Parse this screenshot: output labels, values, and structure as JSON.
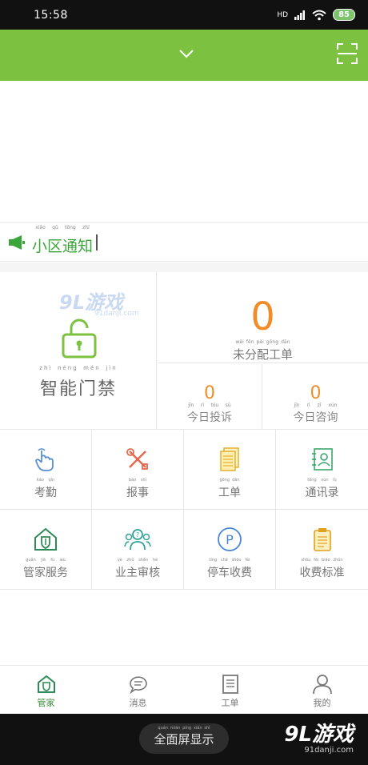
{
  "status_bar": {
    "time": "15:58",
    "network": "HD",
    "battery": "85"
  },
  "notice": {
    "title": "小区通知",
    "title_pinyin": [
      "xiǎo",
      "qū",
      "tōng",
      "zhī"
    ]
  },
  "watermark": {
    "logo": "9L游戏",
    "url": "91danji.com"
  },
  "stats": {
    "gate_label": "智能门禁",
    "gate_pinyin": [
      "zhì",
      "néng",
      "mén",
      "jìn"
    ],
    "unassigned_count": "0",
    "unassigned_label": "未分配工单",
    "unassigned_pinyin": [
      "wèi",
      "fēn",
      "pèi",
      "gōng",
      "dān"
    ],
    "complaints_count": "0",
    "complaints_label": "今日投诉",
    "complaints_pinyin": [
      "jīn",
      "rì",
      "tóu",
      "sù"
    ],
    "consult_count": "0",
    "consult_label": "今日咨询",
    "consult_pinyin": [
      "jīn",
      "rì",
      "zī",
      "xún"
    ]
  },
  "grid": [
    {
      "label": "考勤",
      "pinyin": [
        "kǎo",
        "qín"
      ]
    },
    {
      "label": "报事",
      "pinyin": [
        "bào",
        "shì"
      ]
    },
    {
      "label": "工单",
      "pinyin": [
        "gōng",
        "dān"
      ]
    },
    {
      "label": "通讯录",
      "pinyin": [
        "tōng",
        "xùn",
        "lù"
      ]
    },
    {
      "label": "管家服务",
      "pinyin": [
        "guǎn",
        "jiā",
        "fú",
        "wù"
      ]
    },
    {
      "label": "业主审核",
      "pinyin": [
        "yè",
        "zhǔ",
        "shěn",
        "hé"
      ]
    },
    {
      "label": "停车收费",
      "pinyin": [
        "tíng",
        "chē",
        "shōu",
        "fèi"
      ]
    },
    {
      "label": "收费标准",
      "pinyin": [
        "shōu",
        "fèi",
        "biāo",
        "zhǔn"
      ]
    }
  ],
  "tabs": [
    {
      "label": "管家"
    },
    {
      "label": "消息"
    },
    {
      "label": "工单"
    },
    {
      "label": "我的"
    }
  ],
  "parking_icon_letter": "P",
  "navbar": {
    "fullscreen_label": "全面屏显示",
    "fullscreen_pinyin": [
      "quán",
      "miàn",
      "píng",
      "xiǎn",
      "shì"
    ],
    "brand_logo": "9L游戏",
    "brand_url": "91danji.com"
  },
  "colors": {
    "accent": "#7cc140",
    "number": "#f28c28",
    "notice": "#3aa63a"
  }
}
